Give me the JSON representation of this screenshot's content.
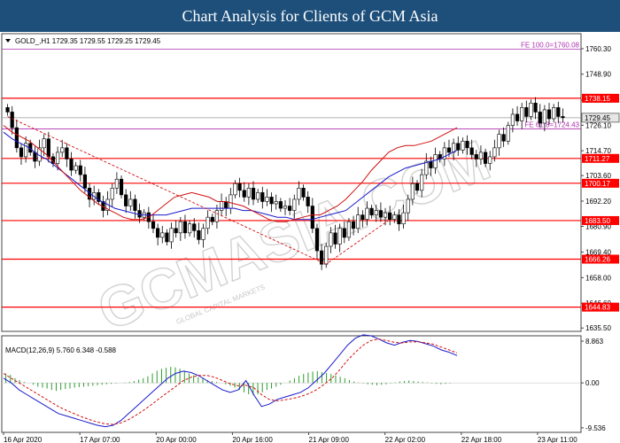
{
  "page": {
    "title": "Chart Analysis for Clients of GCM Asia"
  },
  "chart_data": {
    "type": "candlestick",
    "symbol_header": "GOLD_,H1  1729.35 1729.55 1729.25 1729.45",
    "watermark": "GCMASIA.COM",
    "watermark_sub": "GLOBAL CAPITAL MARKETS",
    "x_ticks": [
      "16 Apr 2020",
      "17 Apr 07:00",
      "20 Apr 00:00",
      "20 Apr 16:00",
      "21 Apr 09:00",
      "22 Apr 02:00",
      "22 Apr 18:00",
      "23 Apr 11:00"
    ],
    "price_axis": {
      "ylim": [
        1634.0,
        1767.0
      ],
      "ticks": [
        "1760.30",
        "1748.90",
        "1737.30",
        "1726.10",
        "1714.70",
        "1703.60",
        "1692.20",
        "1680.90",
        "1669.40",
        "1658.00",
        "1646.60",
        "1635.50"
      ]
    },
    "levels": [
      {
        "value": 1760.08,
        "label": "FE 100.0=1760.08",
        "kind": "fibo"
      },
      {
        "value": 1738.15,
        "label": "1738.15",
        "kind": "sr"
      },
      {
        "value": 1729.45,
        "label": "1729.45",
        "kind": "price"
      },
      {
        "value": 1724.43,
        "label": "FE 61.8=1724.43",
        "kind": "fibo"
      },
      {
        "value": 1711.27,
        "label": "1711.27",
        "kind": "sr"
      },
      {
        "value": 1700.17,
        "label": "1700.17",
        "kind": "sr"
      },
      {
        "value": 1683.5,
        "label": "1683.50",
        "kind": "sr"
      },
      {
        "value": 1666.26,
        "label": "1666.26",
        "kind": "sr"
      },
      {
        "value": 1644.83,
        "label": "1644.83",
        "kind": "sr"
      }
    ],
    "closes": [
      1732.0,
      1725.0,
      1716.0,
      1712.0,
      1718.0,
      1714.0,
      1710.0,
      1716.0,
      1720.0,
      1712.0,
      1709.0,
      1714.0,
      1716.0,
      1711.0,
      1706.0,
      1708.0,
      1704.0,
      1698.0,
      1693.0,
      1696.0,
      1692.0,
      1688.0,
      1693.0,
      1698.0,
      1702.0,
      1695.0,
      1690.0,
      1693.0,
      1688.0,
      1685.0,
      1687.0,
      1683.0,
      1680.0,
      1676.0,
      1678.0,
      1674.0,
      1680.0,
      1678.0,
      1683.0,
      1678.0,
      1682.0,
      1679.0,
      1675.0,
      1680.0,
      1685.0,
      1683.0,
      1688.0,
      1692.0,
      1689.0,
      1695.0,
      1700.0,
      1697.0,
      1694.0,
      1698.0,
      1693.0,
      1696.0,
      1692.0,
      1694.0,
      1691.0,
      1692.0,
      1689.0,
      1690.0,
      1688.0,
      1693.0,
      1698.0,
      1694.0,
      1690.0,
      1680.0,
      1670.0,
      1664.0,
      1672.0,
      1678.0,
      1673.0,
      1680.0,
      1676.0,
      1683.0,
      1680.0,
      1686.0,
      1684.0,
      1689.0,
      1686.0,
      1688.0,
      1685.0,
      1687.0,
      1684.0,
      1686.0,
      1682.0,
      1687.0,
      1693.0,
      1700.0,
      1697.0,
      1704.0,
      1710.0,
      1707.0,
      1713.0,
      1711.0,
      1716.0,
      1714.0,
      1718.0,
      1715.0,
      1719.0,
      1716.0,
      1713.0,
      1711.0,
      1714.0,
      1709.0,
      1712.0,
      1716.0,
      1722.0,
      1719.0,
      1726.0,
      1731.0,
      1728.0,
      1734.0,
      1730.0,
      1736.0,
      1732.0,
      1727.0,
      1733.0,
      1729.0,
      1734.0,
      1730.0,
      1729.45
    ],
    "ma_fast": [
      1726.0,
      1723.0,
      1721.0,
      1719.0,
      1716.0,
      1713.0,
      1709.0,
      1705.0,
      1701.0,
      1697.0,
      1694.0,
      1691.0,
      1689.0,
      1687.0,
      1685.0,
      1684.0,
      1684.0,
      1685.0,
      1688.0,
      1691.0,
      1694.0,
      1695.0,
      1696.0,
      1695.0,
      1694.0,
      1692.0,
      1692.0,
      1691.0,
      1690.0,
      1688.0,
      1686.0,
      1684.0,
      1683.0,
      1683.0,
      1684.0,
      1685.0,
      1686.0,
      1686.0,
      1688.0,
      1690.0,
      1693.0,
      1697.0,
      1701.0,
      1706.0,
      1710.0,
      1714.0,
      1716.0,
      1717.0,
      1717.0,
      1718.0,
      1719.0,
      1721.0,
      1723.0,
      1725.0
    ],
    "ma_slow": [
      1723.0,
      1720.0,
      1718.0,
      1716.0,
      1713.0,
      1711.0,
      1708.0,
      1705.0,
      1702.0,
      1699.0,
      1696.0,
      1693.0,
      1691.0,
      1689.0,
      1688.0,
      1687.0,
      1686.0,
      1686.0,
      1686.0,
      1686.0,
      1687.0,
      1688.0,
      1689.0,
      1689.0,
      1689.0,
      1689.0,
      1689.0,
      1689.0,
      1688.0,
      1688.0,
      1687.0,
      1686.0,
      1685.0,
      1685.0,
      1684.0,
      1684.0,
      1684.0,
      1685.0,
      1686.0,
      1687.0,
      1688.0,
      1691.0,
      1694.0,
      1697.0,
      1700.0,
      1703.0,
      1705.0,
      1707.0,
      1708.0,
      1709.0,
      1710.0,
      1711.0,
      1713.0,
      1715.0
    ],
    "trendline": {
      "points": [
        [
          0,
          1730.0
        ],
        [
          70,
          1664.0
        ],
        [
          84,
          1684.0
        ]
      ]
    },
    "macd": {
      "label": "MACD(12,26,9) 5.760 6.348 -0.588",
      "ylim": [
        -10.5,
        10.0
      ],
      "ticks": [
        "8.863",
        "0.00",
        "-9.536"
      ],
      "histogram": [
        2.0,
        1.7,
        1.0,
        0.6,
        0.2,
        0.0,
        -0.4,
        -0.8,
        -1.0,
        -1.2,
        -1.5,
        -1.7,
        -1.5,
        -1.3,
        -1.2,
        -1.0,
        -0.9,
        -0.8,
        -0.7,
        -0.6,
        -0.5,
        -0.4,
        -0.3,
        -0.2,
        -0.1,
        0.0,
        0.1,
        0.2,
        0.4,
        0.7,
        1.0,
        1.4,
        2.0,
        2.6,
        3.0,
        3.2,
        3.4,
        3.3,
        3.0,
        2.6,
        2.0,
        1.6,
        1.2,
        0.9,
        0.6,
        0.4,
        0.2,
        0.0,
        -0.3,
        -0.6,
        -1.0,
        -1.5,
        -2.0,
        -2.4,
        -2.6,
        -2.4,
        -2.0,
        -1.5,
        -1.2,
        -0.8,
        -0.4,
        0.0,
        0.5,
        1.0,
        1.5,
        1.9,
        2.2,
        2.4,
        2.5,
        2.3,
        2.1,
        1.9,
        1.6,
        1.3,
        1.0,
        0.6,
        0.3,
        0.1,
        -0.1,
        -0.3,
        -0.4,
        -0.5,
        -0.4,
        -0.3,
        -0.1,
        0.1,
        0.3,
        0.4,
        0.5,
        0.4,
        0.3,
        0.2,
        0.1,
        -0.1,
        -0.2,
        -0.3,
        -0.2,
        -0.1,
        0.0
      ],
      "macd_line": [
        1.0,
        0.0,
        -1.5,
        -2.5,
        -3.5,
        -4.5,
        -5.5,
        -6.5,
        -7.0,
        -7.5,
        -8.0,
        -8.5,
        -9.0,
        -9.3,
        -9.0,
        -8.0,
        -6.5,
        -5.0,
        -3.5,
        -2.0,
        -0.5,
        1.0,
        2.0,
        2.5,
        2.2,
        1.5,
        0.5,
        -0.5,
        -1.5,
        -2.0,
        -1.5,
        0.5,
        -2.5,
        -5.0,
        -4.5,
        -3.5,
        -3.0,
        -2.5,
        -2.0,
        -1.0,
        0.5,
        2.0,
        4.0,
        6.0,
        8.0,
        9.5,
        10.2,
        10.0,
        9.3,
        8.5,
        8.0,
        8.6,
        9.0,
        8.8,
        8.3,
        7.8,
        7.0,
        6.5,
        5.8
      ],
      "signal_line": [
        2.0,
        1.0,
        0.0,
        -1.0,
        -2.0,
        -3.0,
        -4.0,
        -5.0,
        -5.8,
        -6.5,
        -7.2,
        -7.8,
        -8.3,
        -8.7,
        -8.8,
        -8.5,
        -7.8,
        -6.8,
        -5.7,
        -4.5,
        -3.2,
        -2.0,
        -0.8,
        0.5,
        1.2,
        1.6,
        1.6,
        1.2,
        0.5,
        -0.2,
        -0.6,
        -0.5,
        -1.0,
        -2.5,
        -3.5,
        -3.8,
        -3.6,
        -3.3,
        -2.9,
        -2.3,
        -1.5,
        -0.3,
        1.0,
        2.8,
        4.8,
        6.5,
        8.0,
        9.0,
        9.3,
        9.0,
        8.6,
        8.5,
        8.7,
        8.7,
        8.5,
        8.2,
        7.6,
        7.0,
        6.348
      ]
    }
  }
}
